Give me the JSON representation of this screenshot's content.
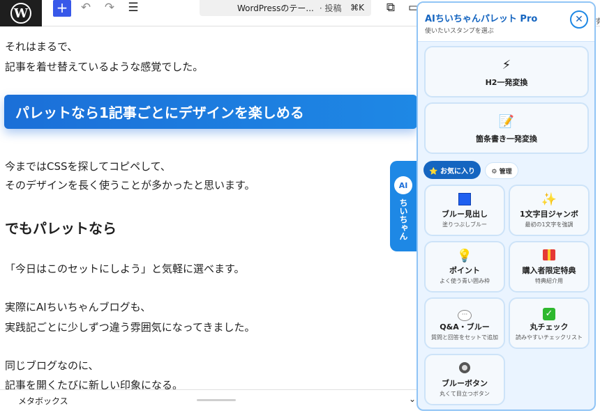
{
  "toolbar": {
    "logo": "W",
    "add_icon": "+",
    "undo_icon": "↶",
    "redo_icon": "↷",
    "list_icon": "☰",
    "command_title": "WordPressのテー...",
    "command_type": "· 投稿",
    "command_shortcut": "⌘K",
    "external_icon": "⧉",
    "view_icon": "▭",
    "edge_text": "す"
  },
  "editor": {
    "p1_line1": "それはまるで、",
    "p1_line2": "記事を着せ替えているような感覚でした。",
    "h2_banner": "パレットなら1記事ごとにデザインを楽しめる",
    "p2_line1": "今まではCSSを探してコピペして、",
    "p2_line2": "そのデザインを長く使うことが多かったと思います。",
    "h3": "でもパレットなら",
    "p3": "「今日はこのセットにしよう」と気軽に選べます。",
    "p4_line1": "実際にAIちいちゃんブログも、",
    "p4_line2": "実践記ごとに少しずつ違う雰囲気になってきました。",
    "p5_line1": "同じブログなのに、",
    "p5_line2": "記事を開くたびに新しい印象になる。"
  },
  "ai_tab": {
    "badge": "AI",
    "label": "ちいちゃん"
  },
  "metabox": {
    "label": "メタボックス",
    "chevron": "⌄"
  },
  "panel": {
    "title": "AIちいちゃんパレット Pro",
    "subtitle": "使いたいスタンプを選ぶ",
    "close": "✕",
    "wide_cards": [
      {
        "icon": "⚡",
        "title": "H2一発変換"
      },
      {
        "icon": "📝",
        "title": "箇条書き一発変換"
      }
    ],
    "tabs": {
      "favorites": "⭐ お気に入り",
      "manage": "⚙ 管理"
    },
    "cards": [
      {
        "icon": "blue-square",
        "title": "ブルー見出し",
        "desc": "塗りつぶしブルー"
      },
      {
        "icon": "✨",
        "title": "1文字目ジャンボ",
        "desc": "最初の1文字を強調"
      },
      {
        "icon": "💡",
        "title": "ポイント",
        "desc": "よく使う青い囲み枠"
      },
      {
        "icon": "gift",
        "title": "購入者限定特典",
        "desc": "特典紹介用"
      },
      {
        "icon": "💬",
        "title": "Q&A・ブルー",
        "desc": "質問と回答をセットで追加"
      },
      {
        "icon": "✓",
        "title": "丸チェック",
        "desc": "読みやすいチェックリスト"
      },
      {
        "icon": "ring",
        "title": "ブルーボタン",
        "desc": "丸くて目立つボタン"
      }
    ]
  }
}
